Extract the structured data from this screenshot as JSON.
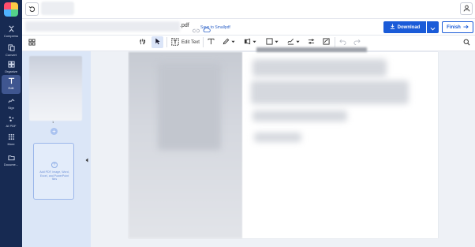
{
  "sidebar": {
    "items": [
      {
        "label": "Compress",
        "icon": "compress-icon"
      },
      {
        "label": "Convert",
        "icon": "convert-icon"
      },
      {
        "label": "Organize",
        "icon": "organize-icon"
      },
      {
        "label": "Edit",
        "icon": "edit-text-icon",
        "active": true
      },
      {
        "label": "Sign",
        "icon": "sign-icon"
      },
      {
        "label": "AI PDF",
        "icon": "ai-sparkle-icon"
      },
      {
        "label": "More",
        "icon": "more-grid-icon"
      },
      {
        "label": "Docume...",
        "icon": "documents-icon"
      }
    ]
  },
  "file": {
    "extension": ".pdf",
    "save_label": "Save to Smallpdf"
  },
  "actions": {
    "download_label": "Download",
    "finish_label": "Finish"
  },
  "toolbar": {
    "edit_text_label": "Edit Text"
  },
  "thumbnails": {
    "page_number": "1",
    "add_file_text": "Add PDF, image, Word, Excel, and PowerPoint files"
  },
  "colors": {
    "rail": "#172a52",
    "accent": "#1a5bd8",
    "thumb_panel": "#dbe6f7"
  }
}
